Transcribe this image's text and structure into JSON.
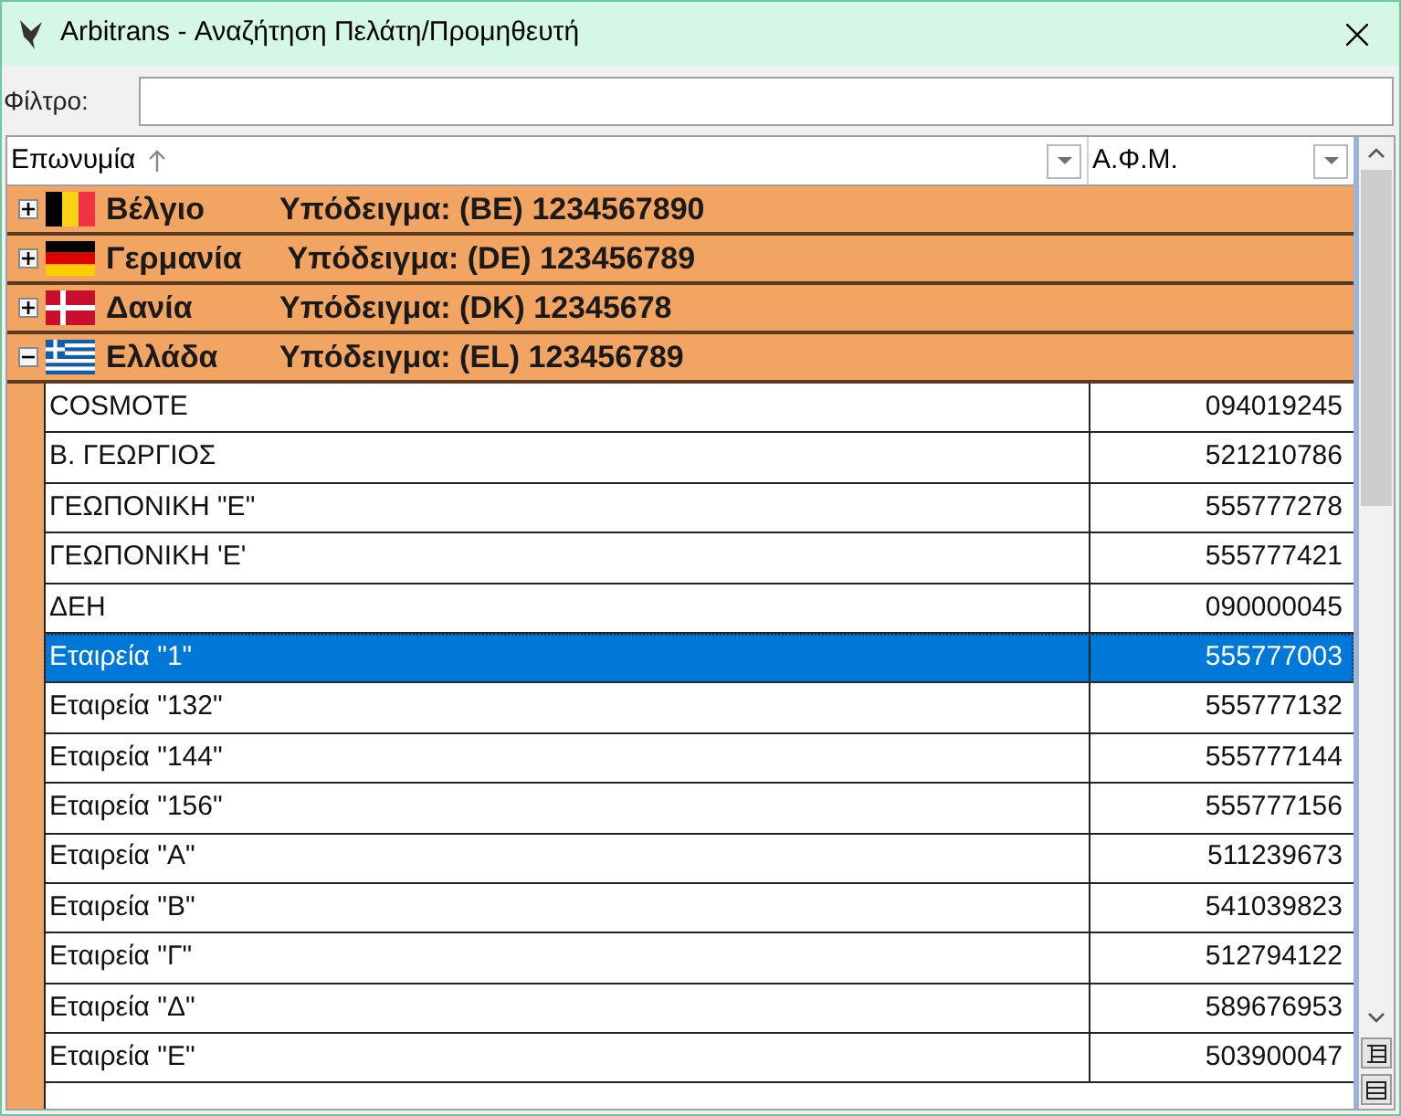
{
  "window": {
    "title": "Arbitrans - Αναζήτηση Πελάτη/Προμηθευτή"
  },
  "filter": {
    "label": "Φίλτρο:"
  },
  "table": {
    "columns": [
      {
        "label": "Επωνυμία",
        "sorted": true
      },
      {
        "label": "Α.Φ.Μ.",
        "sorted": false
      }
    ],
    "groups": [
      {
        "name": "Βέλγιο",
        "hint": "Υπόδειγμα: (BE) 1234567890",
        "kind": "be",
        "expanded": false
      },
      {
        "name": "Γερμανία",
        "hint": "Υπόδειγμα: (DE) 123456789",
        "kind": "de",
        "expanded": false
      },
      {
        "name": "Δανία",
        "hint": "Υπόδειγμα: (DK) 12345678",
        "kind": "dk",
        "expanded": false
      },
      {
        "name": "Ελλάδα",
        "hint": "Υπόδειγμα: (EL) 123456789",
        "kind": "gr",
        "expanded": true,
        "rows": [
          {
            "name": "COSMOTE",
            "vat": "094019245",
            "selected": false
          },
          {
            "name": "Β. ΓΕΩΡΓΙΟΣ",
            "vat": "521210786",
            "selected": false
          },
          {
            "name": "ΓΕΩΠΟΝΙΚΗ \"Ε\"",
            "vat": "555777278",
            "selected": false
          },
          {
            "name": "ΓΕΩΠΟΝΙΚΗ 'Ε'",
            "vat": "555777421",
            "selected": false
          },
          {
            "name": "ΔΕΗ",
            "vat": "090000045",
            "selected": false
          },
          {
            "name": "Εταιρεία \"1\"",
            "vat": "555777003",
            "selected": true
          },
          {
            "name": "Εταιρεία \"132\"",
            "vat": "555777132",
            "selected": false
          },
          {
            "name": "Εταιρεία \"144\"",
            "vat": "555777144",
            "selected": false
          },
          {
            "name": "Εταιρεία \"156\"",
            "vat": "555777156",
            "selected": false
          },
          {
            "name": "Εταιρεία \"Α\"",
            "vat": "511239673",
            "selected": false
          },
          {
            "name": "Εταιρεία \"Β\"",
            "vat": "541039823",
            "selected": false
          },
          {
            "name": "Εταιρεία \"Γ\"",
            "vat": "512794122",
            "selected": false
          },
          {
            "name": "Εταιρεία \"Δ\"",
            "vat": "589676953",
            "selected": false
          },
          {
            "name": "Εταιρεία \"Ε\"",
            "vat": "503900047",
            "selected": false
          }
        ]
      }
    ]
  }
}
